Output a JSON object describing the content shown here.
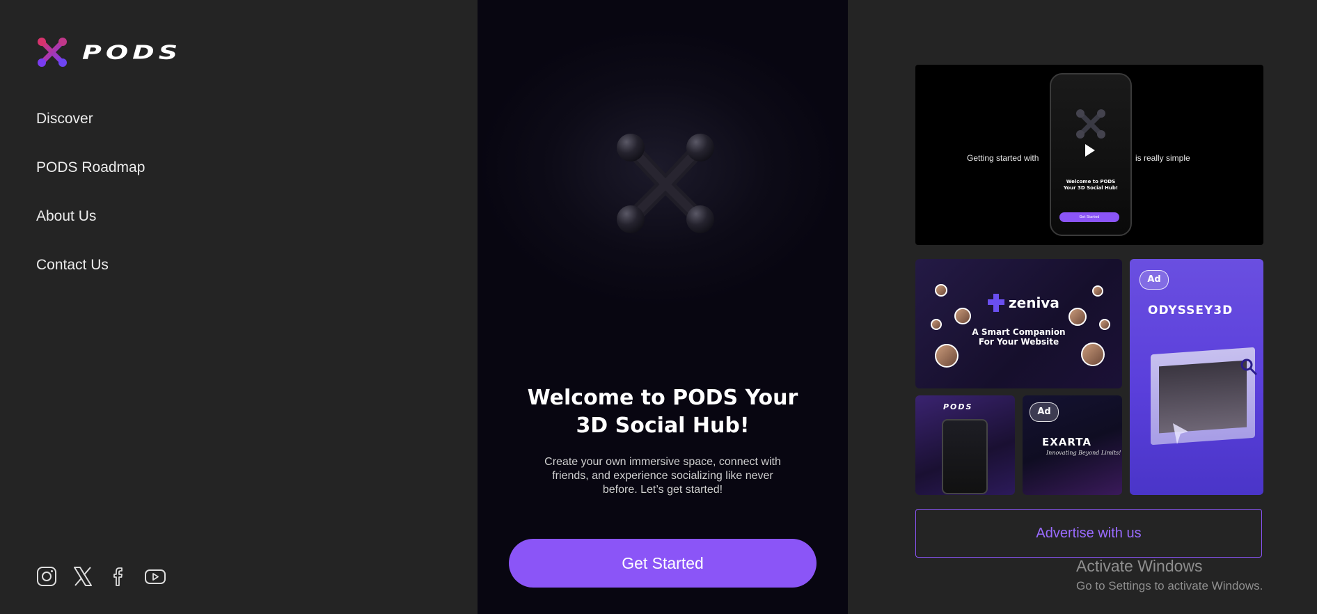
{
  "brand": {
    "name": "PODS",
    "logo_icon": "pods-x-molecule-icon"
  },
  "nav": {
    "items": [
      {
        "label": "Discover"
      },
      {
        "label": "PODS Roadmap"
      },
      {
        "label": "About Us"
      },
      {
        "label": "Contact Us"
      }
    ]
  },
  "socials": [
    {
      "icon": "instagram-icon"
    },
    {
      "icon": "x-twitter-icon"
    },
    {
      "icon": "facebook-icon"
    },
    {
      "icon": "youtube-icon"
    }
  ],
  "hero": {
    "title_line1": "Welcome to PODS Your",
    "title_line2": "3D Social Hub!",
    "subtitle": "Create your own immersive space, connect with friends, and experience socializing like never before. Let’s get started!",
    "cta_label": "Get Started"
  },
  "video_card": {
    "left_text": "Getting started with",
    "right_text": "is really simple",
    "phone_title_line1": "Welcome to PODS",
    "phone_title_line2": "Your 3D Social Hub!",
    "phone_button": "Get Started"
  },
  "ads": {
    "zeniva": {
      "brand": "zeniva",
      "headline_line1": "A Smart Companion",
      "headline_line2": "For Your Website"
    },
    "odyssey": {
      "badge": "Ad",
      "brand": "ODYSSEY3D"
    },
    "pods_mini": {
      "brand": "PODS"
    },
    "exarta": {
      "badge": "Ad",
      "brand": "EXARTA",
      "tagline": "Innovating Beyond Limits!"
    }
  },
  "advertise_label": "Advertise with us",
  "windows_watermark": {
    "title": "Activate Windows",
    "subtitle": "Go to Settings to activate Windows."
  },
  "colors": {
    "accent": "#8b55f7",
    "sidebar_bg": "#242424",
    "hero_bg": "#0d0b17"
  }
}
